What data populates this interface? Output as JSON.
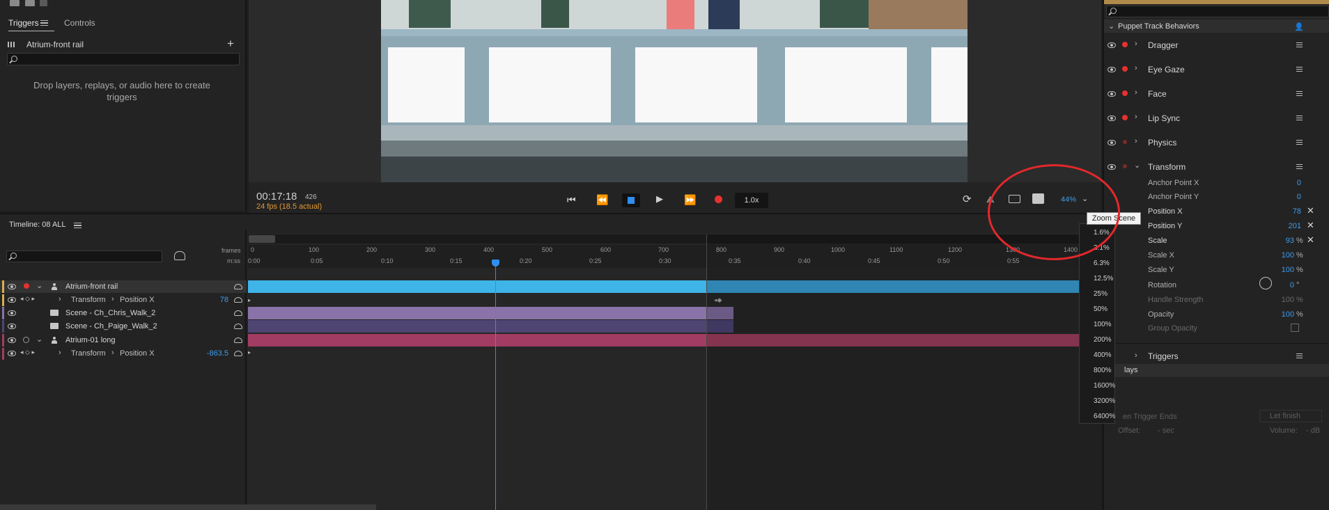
{
  "triggers_panel": {
    "tab_triggers": "Triggers",
    "tab_controls": "Controls",
    "puppet_name": "Atrium-front rail",
    "add": "+",
    "search_placeholder": "",
    "empty_text": "Drop layers, replays, or audio here to create triggers"
  },
  "preview": {
    "timecode": "00:17:18",
    "frame": "426",
    "fps": "24 fps (18.5 actual)",
    "speed": "1.0x",
    "zoom_value": "44%",
    "tooltip": "Zoom Scene"
  },
  "zoom_menu": [
    "1.6%",
    "3.1%",
    "6.3%",
    "12.5%",
    "25%",
    "50%",
    "100%",
    "200%",
    "400%",
    "800%",
    "1600%",
    "3200%",
    "6400%"
  ],
  "properties": {
    "section": "Puppet Track Behaviors",
    "behaviors": [
      "Dragger",
      "Eye Gaze",
      "Face",
      "Lip Sync",
      "Physics",
      "Transform"
    ],
    "transform_params": [
      {
        "label": "Anchor Point X",
        "value": "0",
        "unit": ""
      },
      {
        "label": "Anchor Point Y",
        "value": "0",
        "unit": ""
      },
      {
        "label": "Position X",
        "value": "78",
        "unit": ""
      },
      {
        "label": "Position Y",
        "value": "201",
        "unit": ""
      },
      {
        "label": "Scale",
        "value": "93",
        "unit": "%"
      },
      {
        "label": "Scale X",
        "value": "100",
        "unit": "%"
      },
      {
        "label": "Scale Y",
        "value": "100",
        "unit": "%"
      },
      {
        "label": "Rotation",
        "value": "0",
        "unit": "°"
      },
      {
        "label": "Handle Strength",
        "value": "100",
        "unit": "%"
      },
      {
        "label": "Opacity",
        "value": "100",
        "unit": "%"
      },
      {
        "label": "Group Opacity",
        "value": "",
        "unit": ""
      }
    ],
    "triggers_label": "Triggers",
    "replays_label": "lays",
    "when_trigger_ends": "en Trigger Ends",
    "let_finish": "Let finish",
    "offset_label": "Offset:",
    "offset_value": "- sec",
    "volume_label": "Volume:",
    "volume_value": "- dB"
  },
  "timeline": {
    "title": "Timeline: 08 ALL",
    "frames_label": "frames",
    "mss_label": "m:ss",
    "frame_ticks": [
      "0",
      "100",
      "200",
      "300",
      "400",
      "500",
      "600",
      "700",
      "800",
      "900",
      "1000",
      "1100",
      "1200",
      "1300",
      "1400"
    ],
    "time_ticks": [
      "0:00",
      "0:05",
      "0:10",
      "0:15",
      "0:20",
      "0:25",
      "0:30",
      "0:35",
      "0:40",
      "0:45",
      "0:50",
      "0:55"
    ],
    "rows": [
      {
        "name": "Atrium-front rail",
        "param": "",
        "value": ""
      },
      {
        "name": "Transform",
        "param": "Position X",
        "value": "78"
      },
      {
        "name": "Scene - Ch_Chris_Walk_2",
        "param": "",
        "value": ""
      },
      {
        "name": "Scene - Ch_Paige_Walk_2",
        "param": "",
        "value": ""
      },
      {
        "name": "Atrium-01 long",
        "param": "",
        "value": ""
      },
      {
        "name": "Transform",
        "param": "Position X",
        "value": "-863.5"
      }
    ]
  },
  "colors": {
    "accent_blue": "#2f8ef0",
    "record_red": "#e5322e",
    "fps_orange": "#e39a33",
    "track_blue": "#3fb4e8",
    "track_purple": "#8a73a8",
    "track_darkpurple": "#4e4573",
    "track_pink": "#a33c63"
  }
}
